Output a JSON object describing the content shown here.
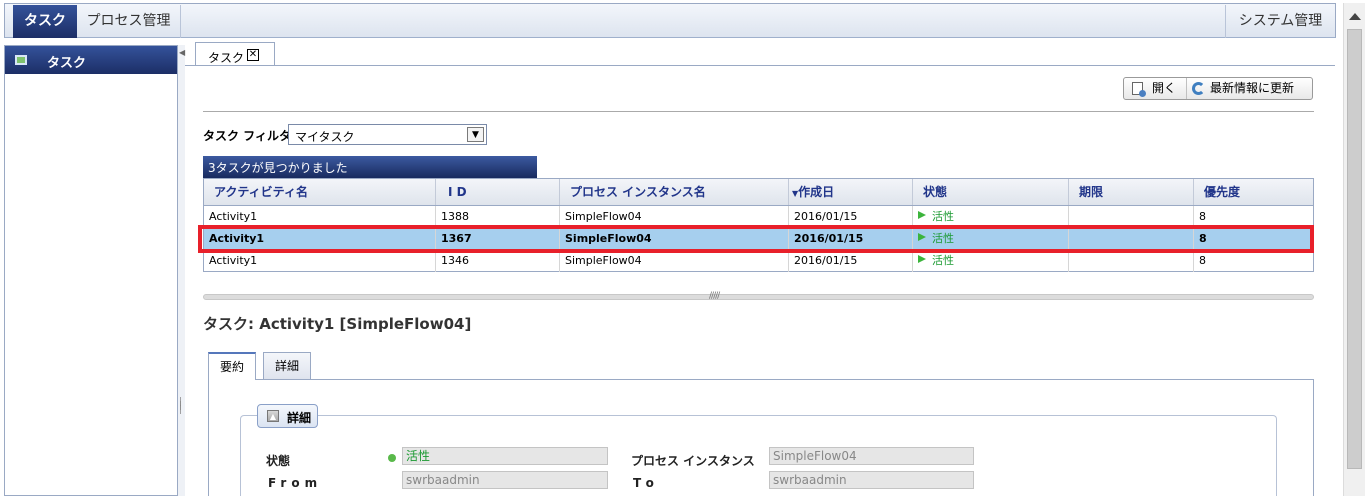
{
  "topnav": {
    "active_tab": "タスク",
    "process_tab": "プロセス管理",
    "system_tab": "システム管理"
  },
  "sidebar": {
    "items": [
      {
        "label": "タスク"
      }
    ]
  },
  "content_tab": {
    "label": "タスク"
  },
  "toolbar": {
    "open_label": "開く",
    "refresh_label": "最新情報に更新"
  },
  "filter": {
    "label": "タスク フィルタ",
    "selected": "マイタスク"
  },
  "result": {
    "summary": "3タスクが見つかりました"
  },
  "table": {
    "columns": [
      "アクティビティ名",
      "I D",
      "プロセス インスタンス名",
      "作成日",
      "状態",
      "期限",
      "優先度"
    ],
    "sorted_column": "作成日",
    "sort_direction": "descending",
    "rows": [
      {
        "activity": "Activity1",
        "id": "1388",
        "instance": "SimpleFlow04",
        "created": "2016/01/15",
        "state": "活性",
        "due": "",
        "priority": "8"
      },
      {
        "activity": "Activity1",
        "id": "1367",
        "instance": "SimpleFlow04",
        "created": "2016/01/15",
        "state": "活性",
        "due": "",
        "priority": "8"
      },
      {
        "activity": "Activity1",
        "id": "1346",
        "instance": "SimpleFlow04",
        "created": "2016/01/15",
        "state": "活性",
        "due": "",
        "priority": "8"
      }
    ],
    "selected_row": 1
  },
  "detail": {
    "title": "タスク: Activity1 [SimpleFlow04]",
    "tabs": [
      "要約",
      "詳細"
    ],
    "section_title": "詳細",
    "fields": {
      "state_label": "状態",
      "state_value": "活性",
      "instance_label": "プロセス インスタンス",
      "instance_value": "SimpleFlow04",
      "from_label": "From",
      "from_value": "swrbaadmin",
      "to_label": "To",
      "to_value": "swrbaadmin"
    }
  },
  "colors": {
    "nav_active": "#1c2e66",
    "selected_row": "#a6cfee",
    "highlight": "#e8202a",
    "state_green": "#1b9a32"
  }
}
